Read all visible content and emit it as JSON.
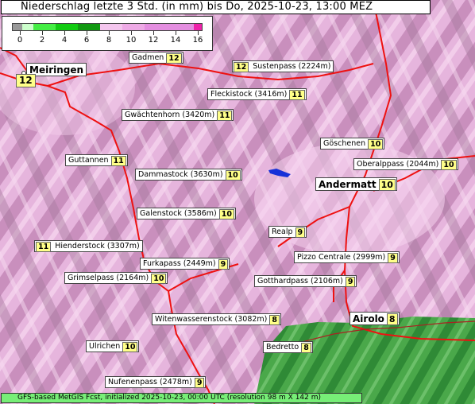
{
  "title": "Niederschlag letzte 3 Std. (in mm) bis Do, 2025-10-23, 13:00 MEZ",
  "legend": {
    "ticks": [
      "0",
      "2",
      "4",
      "6",
      "8",
      "10",
      "12",
      "14",
      "16"
    ],
    "segments": [
      {
        "color": "#999999"
      },
      {
        "color": "#ccffcc"
      },
      {
        "color": "#44ee44"
      },
      {
        "color": "#11cc11"
      },
      {
        "color": "#119911"
      },
      {
        "color": "#f4c6ee"
      },
      {
        "color": "#eeaae6"
      },
      {
        "color": "#e48ee0"
      },
      {
        "color": "#ee22aa"
      }
    ]
  },
  "places": [
    {
      "name": "Meiringen",
      "value": "12"
    },
    {
      "name": "Gadmen",
      "value": "12"
    },
    {
      "name": "Sustenpass (2224m)",
      "value": "12"
    },
    {
      "name": "Fleckistock (3416m)",
      "value": "11"
    },
    {
      "name": "Gwächtenhorn (3420m)",
      "value": "11"
    },
    {
      "name": "Guttannen",
      "value": "11"
    },
    {
      "name": "Dammastock (3630m)",
      "value": "10"
    },
    {
      "name": "Göschenen",
      "value": "10"
    },
    {
      "name": "Oberalppass (2044m)",
      "value": "10"
    },
    {
      "name": "Andermatt",
      "value": "10"
    },
    {
      "name": "Galenstock (3586m)",
      "value": "10"
    },
    {
      "name": "Realp",
      "value": "9"
    },
    {
      "name": "Hienderstock (3307m)",
      "value": "11"
    },
    {
      "name": "Pizzo Centrale (2999m)",
      "value": "9"
    },
    {
      "name": "Furkapass (2449m)",
      "value": "9"
    },
    {
      "name": "Grimselpass (2164m)",
      "value": "10"
    },
    {
      "name": "Gotthardpass (2106m)",
      "value": "9"
    },
    {
      "name": "Airolo",
      "value": "8"
    },
    {
      "name": "Witenwasserenstock (3082m)",
      "value": "8"
    },
    {
      "name": "Ulrichen",
      "value": "10"
    },
    {
      "name": "Bedretto",
      "value": "8"
    },
    {
      "name": "Nufenenpass (2478m)",
      "value": "9"
    }
  ],
  "extra_values": [
    "10"
  ],
  "footer": "GFS-based MetGIS Fcst, initialized 2025-10-23, 00:00 UTC  (resolution 98 m X 142 m)"
}
